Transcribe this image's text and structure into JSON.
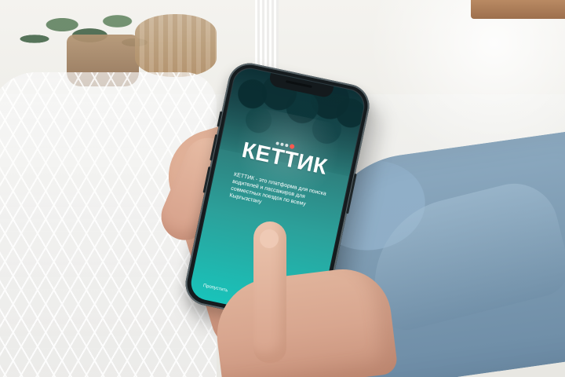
{
  "app": {
    "logo": "КЕТТИК",
    "description": "КЕТТИК - это платформа для поиска водителей и пассажиров для совместных поездок по всему Кыргызстану",
    "skip_label": "Пропустить"
  },
  "colors": {
    "screen_top": "#315a61",
    "screen_middle": "#2e7d7b",
    "screen_bottom": "#19c3ba",
    "logo_text": "#ffffff",
    "logo_accent": "#ff584f"
  },
  "icons": {
    "logo_mark": "logo-dot-mark"
  }
}
